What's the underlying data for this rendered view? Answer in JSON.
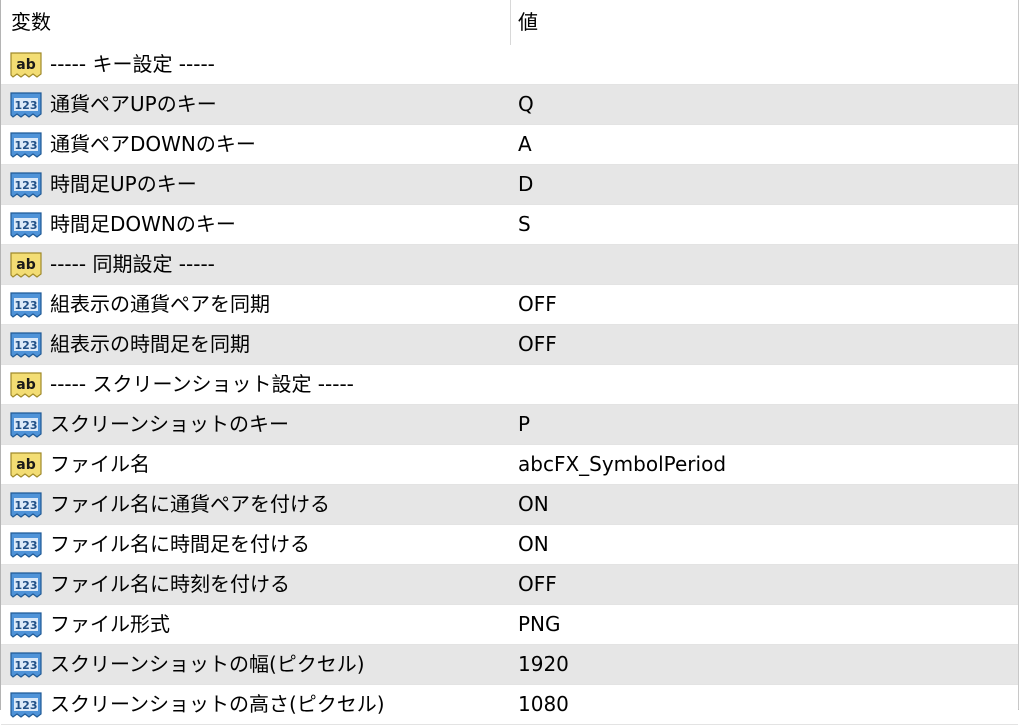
{
  "header": {
    "name_col": "変数",
    "value_col": "値"
  },
  "rows": [
    {
      "type": "string",
      "name": "----- キー設定 -----",
      "value": ""
    },
    {
      "type": "int",
      "name": "通貨ペアUPのキー",
      "value": "Q"
    },
    {
      "type": "int",
      "name": "通貨ペアDOWNのキー",
      "value": "A"
    },
    {
      "type": "int",
      "name": "時間足UPのキー",
      "value": "D"
    },
    {
      "type": "int",
      "name": "時間足DOWNのキー",
      "value": "S"
    },
    {
      "type": "string",
      "name": "----- 同期設定 -----",
      "value": ""
    },
    {
      "type": "int",
      "name": "組表示の通貨ペアを同期",
      "value": "OFF"
    },
    {
      "type": "int",
      "name": "組表示の時間足を同期",
      "value": "OFF"
    },
    {
      "type": "string",
      "name": "----- スクリーンショット設定 -----",
      "value": ""
    },
    {
      "type": "int",
      "name": "スクリーンショットのキー",
      "value": "P"
    },
    {
      "type": "string",
      "name": "ファイル名",
      "value": "abcFX_SymbolPeriod"
    },
    {
      "type": "int",
      "name": "ファイル名に通貨ペアを付ける",
      "value": "ON"
    },
    {
      "type": "int",
      "name": "ファイル名に時間足を付ける",
      "value": "ON"
    },
    {
      "type": "int",
      "name": "ファイル名に時刻を付ける",
      "value": "OFF"
    },
    {
      "type": "int",
      "name": "ファイル形式",
      "value": "PNG"
    },
    {
      "type": "int",
      "name": "スクリーンショットの幅(ピクセル)",
      "value": "1920"
    },
    {
      "type": "int",
      "name": "スクリーンショットの高さ(ピクセル)",
      "value": "1080"
    }
  ],
  "icons": {
    "string": "ab-string-icon",
    "int": "123-integer-icon"
  },
  "colors": {
    "row_alt": "#e6e6e6",
    "row_base": "#ffffff",
    "ab_icon": "#f0d86a",
    "int_icon": "#3c7fc4"
  }
}
